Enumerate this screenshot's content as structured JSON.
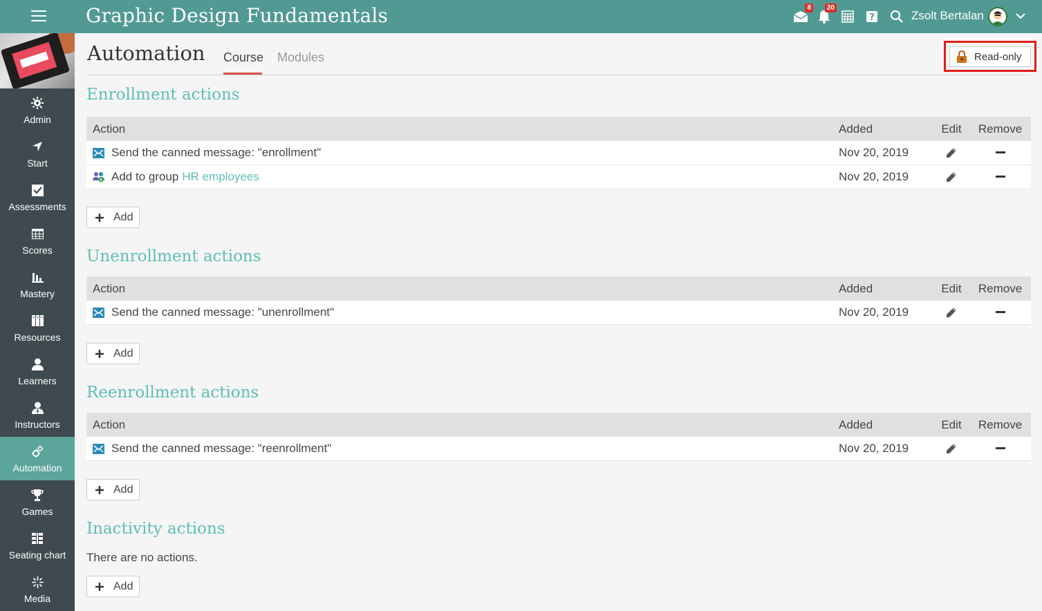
{
  "header": {
    "course_title": "Graphic Design Fundamentals",
    "messages_badge": "8",
    "notifications_badge": "20",
    "user_name": "Zsolt Bertalan"
  },
  "colors": {
    "topbar": "#519a93",
    "sidebar": "#3e4a4f",
    "active": "#5ca59d",
    "accent_text": "#5dbfb4",
    "badge": "#d9302b",
    "highlight": "#e21b1b"
  },
  "sidebar": {
    "items": [
      {
        "label": "Admin",
        "icon": "gear-icon"
      },
      {
        "label": "Start",
        "icon": "navigation-arrow-icon"
      },
      {
        "label": "Assessments",
        "icon": "checkbox-icon"
      },
      {
        "label": "Scores",
        "icon": "gradebook-icon"
      },
      {
        "label": "Mastery",
        "icon": "bar-chart-icon"
      },
      {
        "label": "Resources",
        "icon": "books-icon"
      },
      {
        "label": "Learners",
        "icon": "person-icon"
      },
      {
        "label": "Instructors",
        "icon": "instructor-icon"
      },
      {
        "label": "Automation",
        "icon": "gears-icon"
      },
      {
        "label": "Games",
        "icon": "trophy-icon"
      },
      {
        "label": "Seating chart",
        "icon": "seating-grid-icon"
      },
      {
        "label": "Media",
        "icon": "sparkle-icon"
      }
    ]
  },
  "page": {
    "title": "Automation",
    "tabs": [
      {
        "label": "Course"
      },
      {
        "label": "Modules"
      }
    ],
    "readonly_label": "Read-only"
  },
  "table_headers": {
    "action": "Action",
    "added": "Added",
    "edit": "Edit",
    "remove": "Remove"
  },
  "add_label": "Add",
  "sections": {
    "enrollment": {
      "title": "Enrollment actions",
      "rows": [
        {
          "text": "Send the canned message: \"enrollment\"",
          "link": "",
          "added": "Nov 20, 2019"
        },
        {
          "text": "Add to group",
          "link": "HR employees",
          "added": "Nov 20, 2019"
        }
      ]
    },
    "unenrollment": {
      "title": "Unenrollment actions",
      "rows": [
        {
          "text": "Send the canned message: \"unenrollment\"",
          "added": "Nov 20, 2019"
        }
      ]
    },
    "reenrollment": {
      "title": "Reenrollment actions",
      "rows": [
        {
          "text": "Send the canned message: \"reenrollment\"",
          "added": "Nov 20, 2019"
        }
      ]
    },
    "inactivity": {
      "title": "Inactivity actions",
      "empty_text": "There are no actions."
    }
  }
}
